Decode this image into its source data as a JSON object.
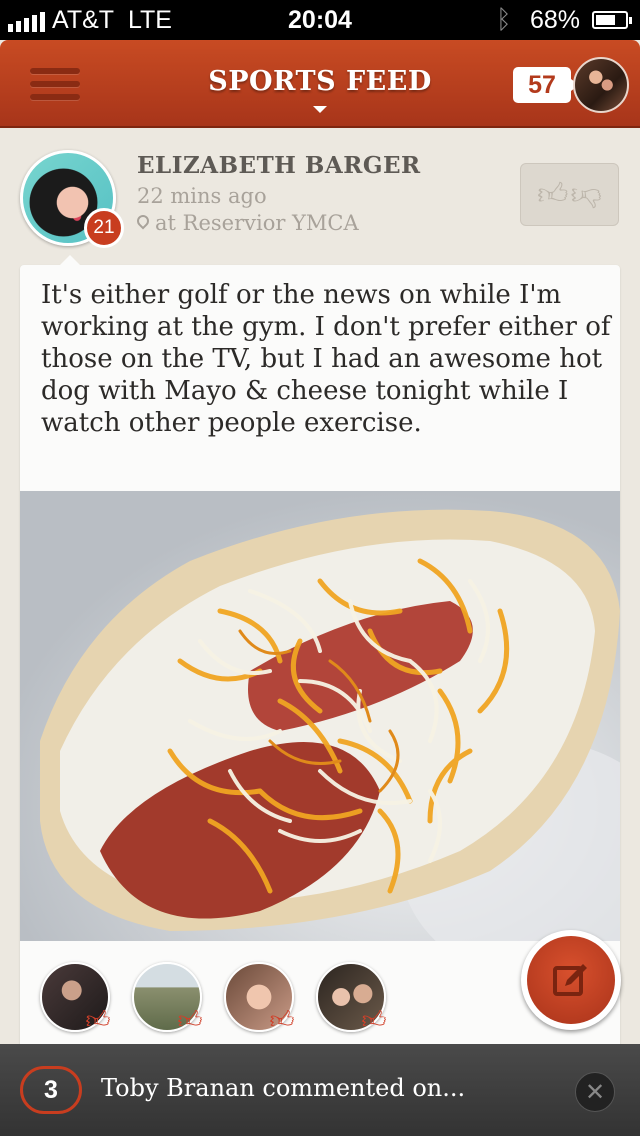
{
  "status_bar": {
    "carrier": "AT&T",
    "network": "LTE",
    "time": "20:04",
    "battery": "68%",
    "battery_level": 0.68
  },
  "nav": {
    "title": "SPORTS FEED",
    "notification_count": "57"
  },
  "post": {
    "author": "ELIZABETH BARGER",
    "author_badge": "21",
    "time_ago": "22 mins ago",
    "location": "at Reservior YMCA",
    "text": "It's either golf or the news on while I'm working at the gym. I don't prefer either of those on the TV, but I had an awesome hot dog with Mayo & cheese tonight while I watch other people exercise.",
    "likers_count": 4
  },
  "notification": {
    "count": "3",
    "text": "Toby Branan commented on..."
  },
  "icons": {
    "menu": "hamburger-icon",
    "vote": "thumbs-up-down-icon",
    "location": "pin-icon",
    "compose": "compose-icon",
    "dismiss": "close-icon",
    "like": "thumbs-up-icon"
  },
  "colors": {
    "accent": "#c0441f",
    "background": "#ece8e0",
    "notification_bar": "#3c3c3c"
  }
}
